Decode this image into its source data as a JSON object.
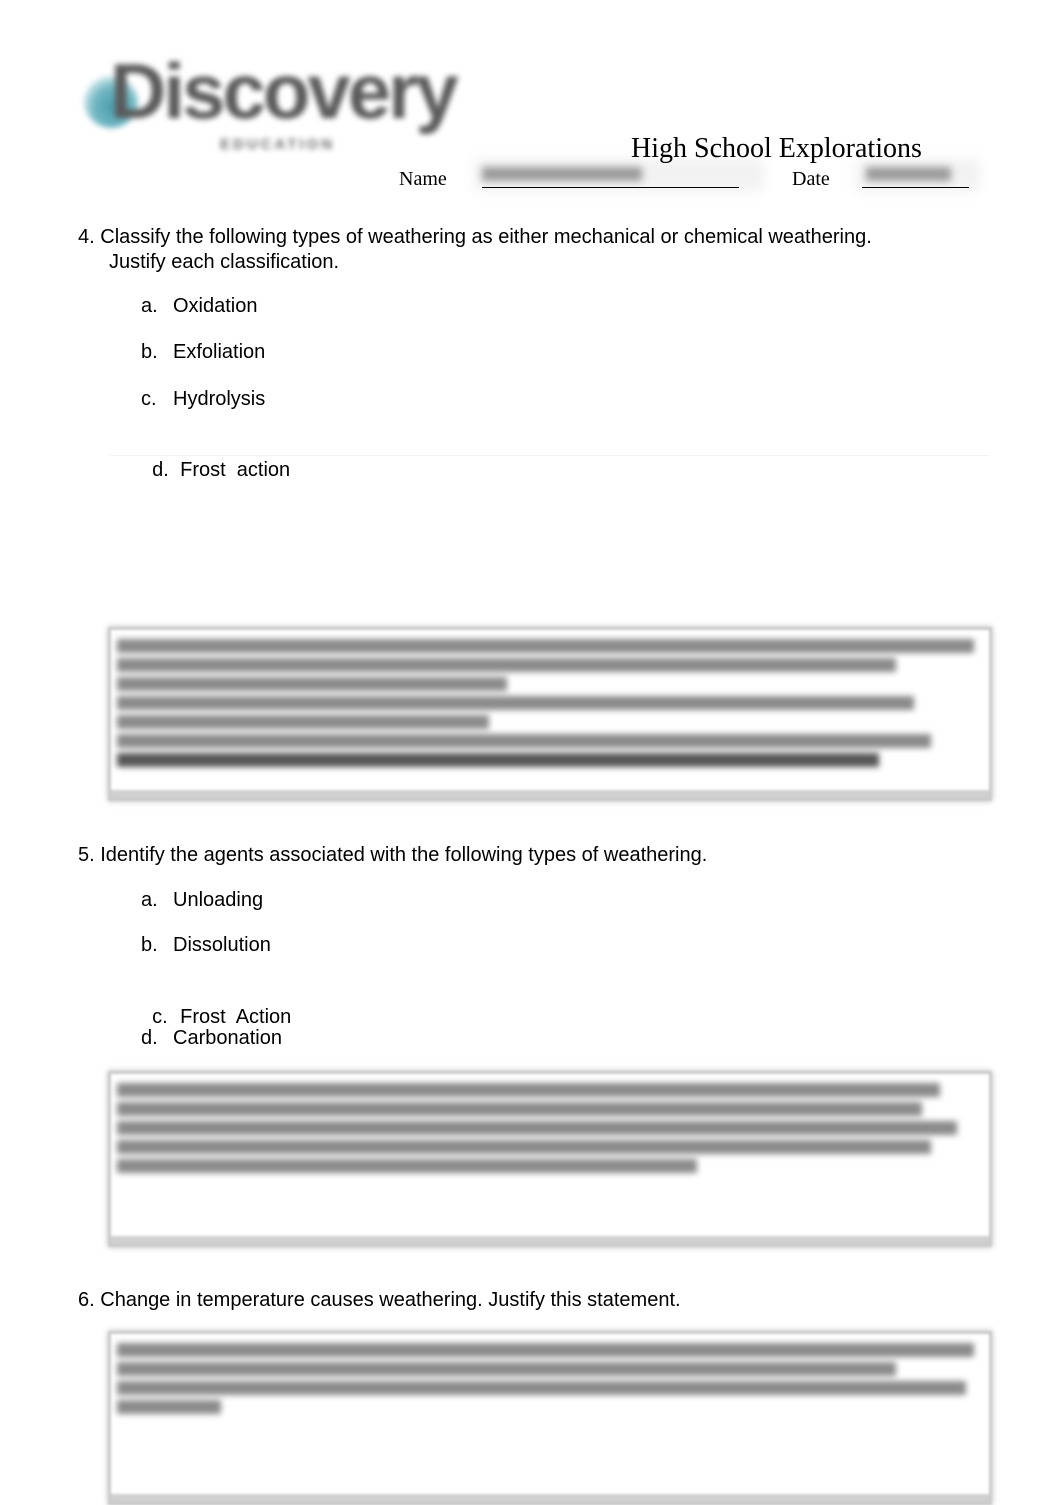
{
  "header": {
    "logo_text": "Discovery",
    "logo_subtext": "EDUCATION",
    "title": "High School Explorations",
    "name_label": "Name",
    "date_label": "Date",
    "name_value_obscured": true,
    "date_value_obscured": true
  },
  "questions": [
    {
      "number": "4.",
      "text_line1": "Classify the following types of weathering as either mechanical or chemical weathering.",
      "text_line2": "Justify each classification.",
      "items": [
        {
          "letter": "a.",
          "label": "Oxidation"
        },
        {
          "letter": "b.",
          "label": "Exfoliation"
        },
        {
          "letter": "c.",
          "label": "Hydrolysis"
        },
        {
          "letter": "d.",
          "label": "Frost  action"
        }
      ],
      "answer_obscured": true
    },
    {
      "number": "5.",
      "text": "Identify the agents associated with the following types of weathering.",
      "items": [
        {
          "letter": "a.",
          "label": "Unloading"
        },
        {
          "letter": "b.",
          "label": "Dissolution"
        },
        {
          "letter": "c.",
          "label": "Frost  Action"
        },
        {
          "letter": "d.",
          "label": "Carbonation"
        }
      ],
      "answer_obscured": true
    },
    {
      "number": "6.",
      "text": "Change in temperature causes weathering. Justify this statement.",
      "answer_obscured": true
    }
  ],
  "colors": {
    "logo_globe": "#4a9aaa",
    "logo_text": "#5a5a5a",
    "answer_border": "#c9c9c9"
  }
}
